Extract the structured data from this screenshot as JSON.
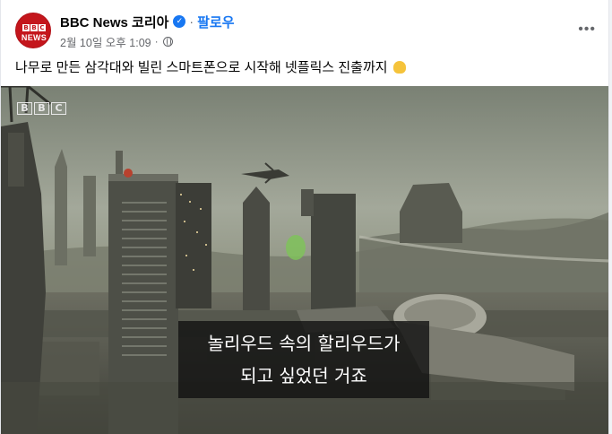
{
  "page": {
    "name": "BBC News 코리아",
    "follow_label": "팔로우",
    "separator": "·",
    "timestamp": "2월 10일 오후 1:09",
    "meta_separator": "·",
    "more_icon": "more-horizontal-icon",
    "audience_icon": "globe-icon"
  },
  "avatar": {
    "letters": [
      "B",
      "B",
      "C"
    ],
    "label": "NEWS",
    "color": "#c4161c"
  },
  "post": {
    "text": "나무로 만든 삼각대와 빌린 스마트폰으로 시작해 넷플릭스 진출까지",
    "emoji_icon": "clapping-hands-icon"
  },
  "video": {
    "watermark_letters": [
      "B",
      "B",
      "C"
    ],
    "subtitle_line1": "놀리우드 속의 할리우드가",
    "subtitle_line2": "되고 싶었던 거죠"
  },
  "colors": {
    "accent": "#1877f2",
    "text_secondary": "#65676b",
    "brand_red": "#c4161c"
  }
}
